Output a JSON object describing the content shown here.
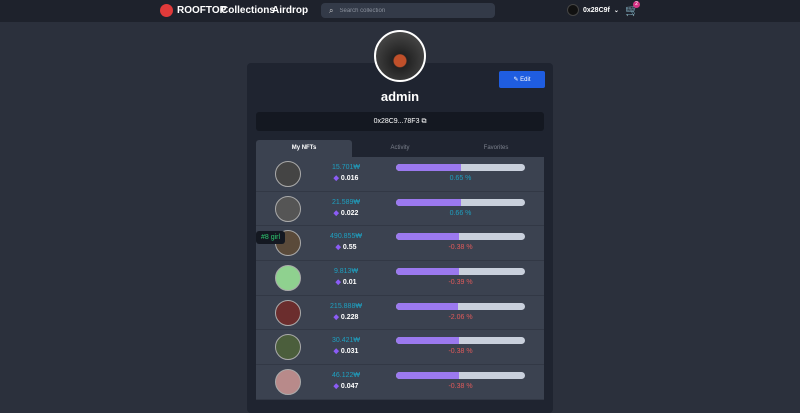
{
  "nav": {
    "brand": "ROOFTOP",
    "links": [
      "Collections",
      "Airdrop"
    ],
    "search_placeholder": "Search collection",
    "user": "0x28C9f",
    "cart_count": "2"
  },
  "profile": {
    "name": "admin",
    "address": "0x28C9...78F3",
    "edit_label": "Edit"
  },
  "tabs": [
    "My NFTs",
    "Activity",
    "Favorites"
  ],
  "tooltip": "#8 girl",
  "colors": {
    "positive": "#1ea0c0",
    "negative": "#e05a5a",
    "accent": "#1f5de0"
  },
  "nfts": [
    {
      "price": "15.701₩",
      "eth": "0.016",
      "change": "0.65 %",
      "trend": "up",
      "progress": 50,
      "thumb": "#444"
    },
    {
      "price": "21.589₩",
      "eth": "0.022",
      "change": "0.66 %",
      "trend": "up",
      "progress": 50,
      "thumb": "#555"
    },
    {
      "price": "490.855₩",
      "eth": "0.55",
      "change": "-0.38 %",
      "trend": "down",
      "progress": 49,
      "thumb": "#5a4a3a"
    },
    {
      "price": "9.813₩",
      "eth": "0.01",
      "change": "-0.39 %",
      "trend": "down",
      "progress": 49,
      "thumb": "#8fd18f"
    },
    {
      "price": "215.888₩",
      "eth": "0.228",
      "change": "-2.06 %",
      "trend": "down",
      "progress": 48,
      "thumb": "#6b2d2d"
    },
    {
      "price": "30.421₩",
      "eth": "0.031",
      "change": "-0.38 %",
      "trend": "down",
      "progress": 49,
      "thumb": "#4b5e3c"
    },
    {
      "price": "46.122₩",
      "eth": "0.047",
      "change": "-0.38 %",
      "trend": "down",
      "progress": 49,
      "thumb": "#b88a8a"
    }
  ]
}
